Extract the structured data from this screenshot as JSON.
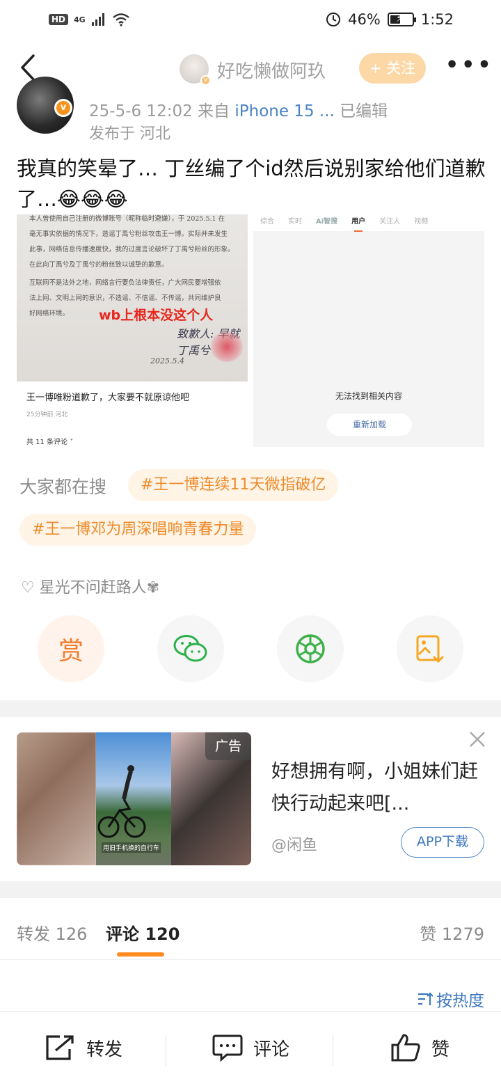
{
  "status_bar": {
    "network": "4G",
    "battery": "46%",
    "battery_level": 0.46,
    "time": "1:52"
  },
  "nav": {
    "username": "好吃懒做阿玖",
    "follow": "+ 关注"
  },
  "post": {
    "datetime": "25-5-6 12:02",
    "source_prefix": "来自",
    "source": "iPhone 15 ...",
    "edited": "已编辑",
    "location": "发布于 河北",
    "text": "我真的笑晕了… 丁丝编了个id然后说别家给他们道歉了…😂😂😂"
  },
  "image_left": {
    "doc_lines": [
      "本人曾使用自己注册的微博账号（昵称临时避嫌），于 2025.5.1 在",
      "毫无事实依据的情况下，造谣丁禹兮粉丝攻击王一博。实际并未发生",
      "此事，网络信息传播速度快，我的过度言论破坏了丁禹兮粉丝的形象。",
      "在此向丁禹兮及丁禹兮的粉丝致以诚挚的歉意。",
      "互联网不是法外之地，网络言行要负法律责任，广大网民要增强依",
      "法上网、文明上网的意识，不造谣、不信谣、不传谣，共同维护良",
      "好网络环境。"
    ],
    "overlay": "wb上根本没这个人",
    "signature": "致歉人: 早就丁禹兮",
    "date": "2025.5.4",
    "caption_title": "王一博唯粉道歉了，大家要不就原谅他吧",
    "caption_meta": "25分钟前 河北",
    "caption_comments": "共 11 条评论 ˅"
  },
  "image_right": {
    "tabs": [
      "综合",
      "实时",
      "Ai智搜",
      "用户",
      "关注人",
      "视频"
    ],
    "active_tab": "用户",
    "empty_text": "无法找到相关内容",
    "reload": "重新加载"
  },
  "hot_search": {
    "label": "大家都在搜",
    "chips": [
      "#王一博连续11天微指破亿",
      "#王一博邓为周深唱响青春力量"
    ]
  },
  "like_line": "♡ 星光不问赶路人✾",
  "actions": {
    "reward": "赏",
    "wechat_icon": "wechat-icon",
    "moments_icon": "moments-icon",
    "save_icon": "save-image-icon"
  },
  "ad": {
    "tag": "广告",
    "title": "好想拥有啊，小姐妹们赶快行动起来吧[...",
    "source": "@闲鱼",
    "button": "APP下载",
    "image_caption": "用旧手机换的自行车"
  },
  "counts": {
    "repost": "转发 126",
    "comment": "评论 120",
    "like": "赞 1279"
  },
  "sort": "按热度",
  "bottom": {
    "repost": "转发",
    "comment": "评论",
    "like": "赞"
  },
  "colors": {
    "accent": "#ff8a1f",
    "link": "#3e78c0",
    "follow_bg": "#fcd8a7",
    "chip_bg": "#fff4e6",
    "chip_text": "#ee8b2b"
  }
}
